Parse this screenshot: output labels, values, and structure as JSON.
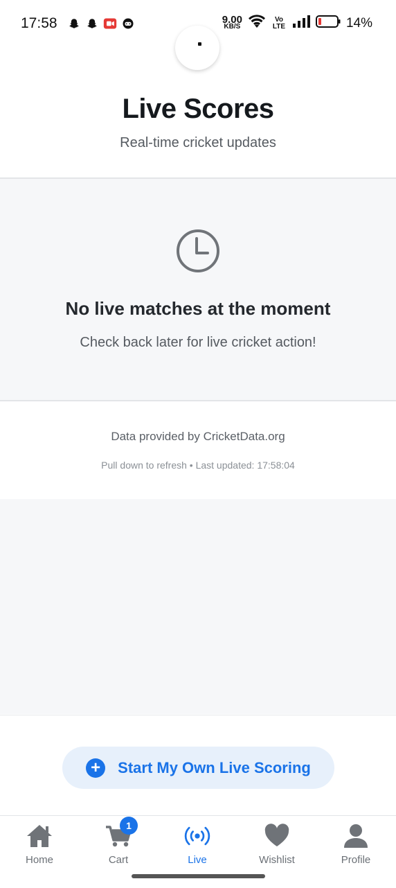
{
  "status_bar": {
    "time": "17:58",
    "net_speed": "9.00",
    "net_unit": "KB/S",
    "volte": "Vo LTE",
    "battery": "14%"
  },
  "header": {
    "title": "Live Scores",
    "subtitle": "Real-time cricket updates"
  },
  "empty_state": {
    "icon": "clock-icon",
    "title": "No live matches at the moment",
    "text": "Check back later for live cricket action!"
  },
  "info": {
    "provider": "Data provided by CricketData.org",
    "refresh": "Pull down to refresh • Last updated: 17:58:04"
  },
  "cta": {
    "label": "Start My Own Live Scoring",
    "icon": "plus-icon"
  },
  "bottom_nav": {
    "items": [
      {
        "label": "Home",
        "icon": "home-icon"
      },
      {
        "label": "Cart",
        "icon": "cart-icon",
        "badge": "1"
      },
      {
        "label": "Live",
        "icon": "live-broadcast-icon",
        "active": true
      },
      {
        "label": "Wishlist",
        "icon": "heart-icon"
      },
      {
        "label": "Profile",
        "icon": "person-icon"
      }
    ]
  },
  "colors": {
    "accent": "#1a73e8",
    "panel": "#f6f7f9",
    "battery_low": "#e53935"
  }
}
